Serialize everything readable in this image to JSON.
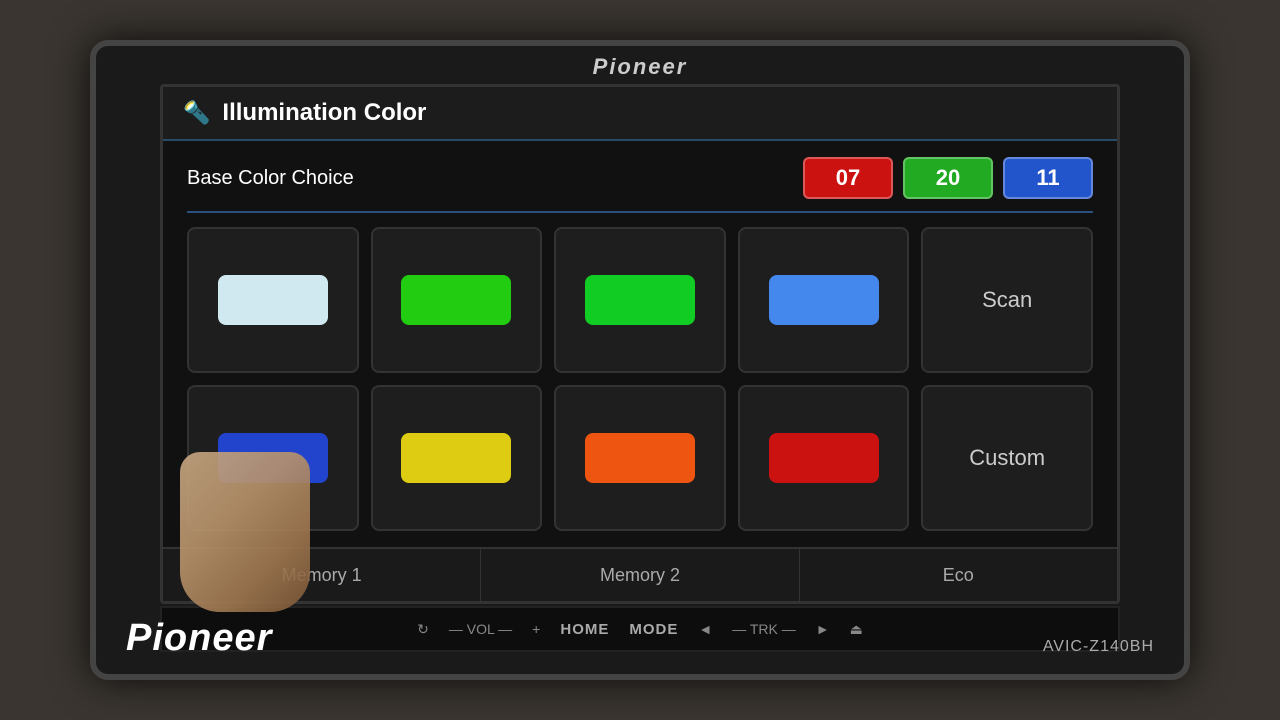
{
  "brand_top": "Pioneer",
  "brand_bottom": "Pioneer",
  "model": "AVIC-Z140BH",
  "header": {
    "icon": "🔧",
    "title": "Illumination Color"
  },
  "base_color": {
    "label": "Base Color Choice",
    "red_value": "07",
    "green_value": "20",
    "blue_value": "11"
  },
  "color_grid_row1": [
    {
      "color": "#d0e8f0",
      "label": "white-swatch"
    },
    {
      "color": "#22cc11",
      "label": "bright-green-swatch"
    },
    {
      "color": "#11cc22",
      "label": "green-swatch"
    },
    {
      "color": "#4488ee",
      "label": "blue-swatch"
    }
  ],
  "color_grid_row2": [
    {
      "color": "#2244cc",
      "label": "dark-blue-swatch"
    },
    {
      "color": "#ddcc11",
      "label": "yellow-swatch"
    },
    {
      "color": "#ee5511",
      "label": "orange-swatch"
    },
    {
      "color": "#cc1111",
      "label": "red-swatch"
    }
  ],
  "scan_label": "Scan",
  "custom_label": "Custom",
  "bottom_buttons": [
    {
      "label": "Memory 1"
    },
    {
      "label": "Memory 2"
    },
    {
      "label": "Eco"
    }
  ],
  "controls": {
    "vol_minus": "—  VOL  —",
    "vol_plus": "+",
    "home": "HOME",
    "mode": "MODE",
    "trk": "◄ — TRK — ►",
    "eject": "⏏"
  }
}
